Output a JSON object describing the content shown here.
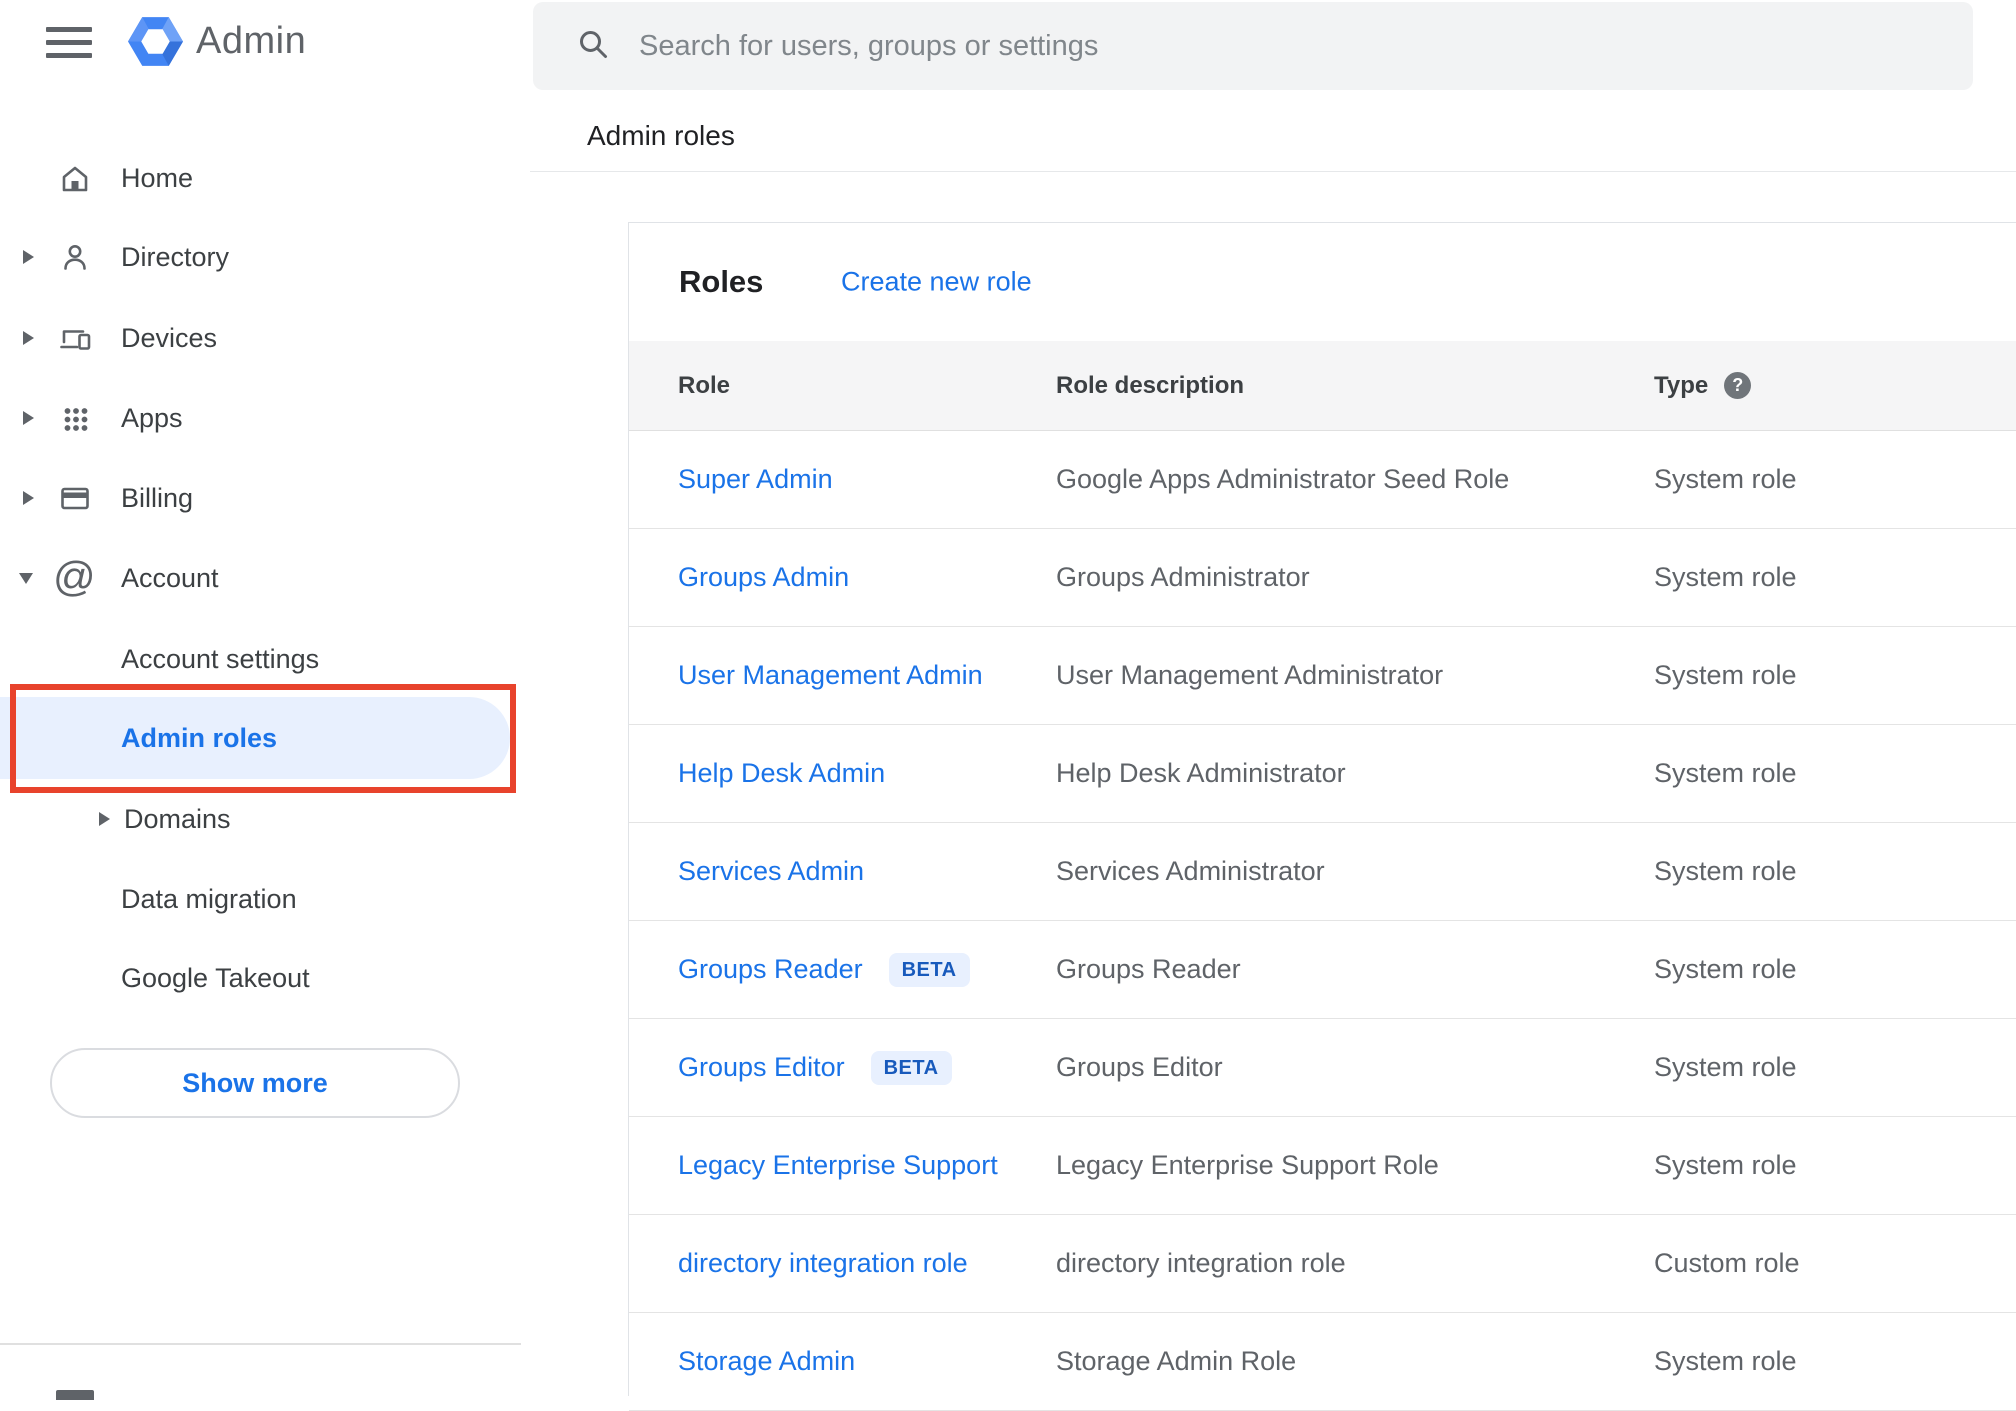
{
  "app": {
    "name": "Admin"
  },
  "colors": {
    "accent_blue": "#1a73e8",
    "selected_bg": "#e8f0fe",
    "annotation_red": "#e8432c",
    "beta_text": "#185abc",
    "table_header_bg": "#f5f5f6",
    "icon_gray": "#5f6368"
  },
  "topbar": {
    "search_placeholder": "Search for users, groups or settings"
  },
  "breadcrumb": "Admin roles",
  "sidebar": {
    "items": [
      {
        "label": "Home",
        "icon": "home"
      },
      {
        "label": "Directory",
        "icon": "person",
        "expandable": true
      },
      {
        "label": "Devices",
        "icon": "devices",
        "expandable": true
      },
      {
        "label": "Apps",
        "icon": "apps-grid",
        "expandable": true
      },
      {
        "label": "Billing",
        "icon": "credit-card",
        "expandable": true
      },
      {
        "label": "Account",
        "icon": "at-sign",
        "expandable": true,
        "expanded": true
      }
    ],
    "account_children": [
      {
        "label": "Account settings"
      },
      {
        "label": "Admin roles",
        "selected": true,
        "annotated": true
      },
      {
        "label": "Domains",
        "expandable": true
      },
      {
        "label": "Data migration"
      },
      {
        "label": "Google Takeout"
      }
    ],
    "show_more_label": "Show more"
  },
  "roles_panel": {
    "title": "Roles",
    "create_link": "Create new role",
    "columns": [
      "Role",
      "Role description",
      "Type"
    ],
    "help_glyph": "?",
    "beta_label": "BETA",
    "rows": [
      {
        "role": "Super Admin",
        "beta": false,
        "description": "Google Apps Administrator Seed Role",
        "type": "System role"
      },
      {
        "role": "Groups Admin",
        "beta": false,
        "description": "Groups Administrator",
        "type": "System role"
      },
      {
        "role": "User Management Admin",
        "beta": false,
        "description": "User Management Administrator",
        "type": "System role"
      },
      {
        "role": "Help Desk Admin",
        "beta": false,
        "description": "Help Desk Administrator",
        "type": "System role"
      },
      {
        "role": "Services Admin",
        "beta": false,
        "description": "Services Administrator",
        "type": "System role"
      },
      {
        "role": "Groups Reader",
        "beta": true,
        "description": "Groups Reader",
        "type": "System role"
      },
      {
        "role": "Groups Editor",
        "beta": true,
        "description": "Groups Editor",
        "type": "System role"
      },
      {
        "role": "Legacy Enterprise Support",
        "beta": false,
        "description": "Legacy Enterprise Support Role",
        "type": "System role"
      },
      {
        "role": "directory integration role",
        "beta": false,
        "description": "directory integration role",
        "type": "Custom role"
      },
      {
        "role": "Storage Admin",
        "beta": false,
        "description": "Storage Admin Role",
        "type": "System role"
      }
    ]
  }
}
